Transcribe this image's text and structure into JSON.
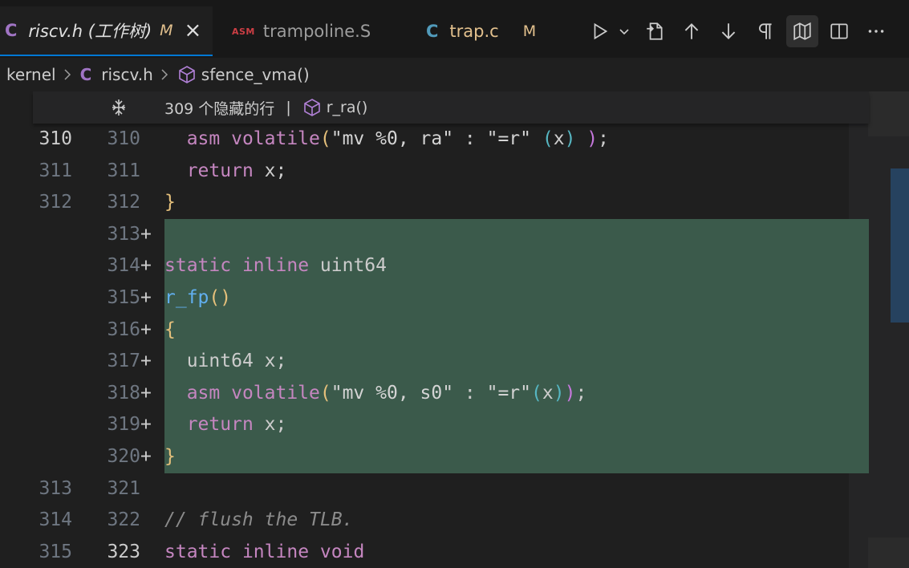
{
  "tabs": [
    {
      "icon": "C",
      "name": "riscv.h (工作树)",
      "badge": "M",
      "close": "×"
    },
    {
      "icon": "ASM",
      "name": "trampoline.S"
    },
    {
      "icon": "C",
      "name": "trap.c",
      "badge": "M"
    }
  ],
  "breadcrumb": {
    "folder": "kernel",
    "file_icon": "C",
    "file": "riscv.h",
    "symbol": "sfence_vma()"
  },
  "sticky": {
    "hidden_lines": "309 个隐藏的行",
    "separator": "|",
    "symbol": "r_ra()"
  },
  "gutter": {
    "plus": "+"
  },
  "lines": [
    {
      "old": "310",
      "new": "310"
    },
    {
      "old": "311",
      "new": "311"
    },
    {
      "old": "312",
      "new": "312"
    },
    {
      "old": "",
      "new": "313"
    },
    {
      "old": "",
      "new": "314"
    },
    {
      "old": "",
      "new": "315"
    },
    {
      "old": "",
      "new": "316"
    },
    {
      "old": "",
      "new": "317"
    },
    {
      "old": "",
      "new": "318"
    },
    {
      "old": "",
      "new": "319"
    },
    {
      "old": "",
      "new": "320"
    },
    {
      "old": "313",
      "new": "321"
    },
    {
      "old": "314",
      "new": "322"
    },
    {
      "old": "315",
      "new": "323"
    }
  ],
  "code": {
    "l310": {
      "kw": "asm volatile",
      "open": "(",
      "str": "\"mv %0, ra\"",
      "colon": " : ",
      "cons": "\"=r\"",
      "sp": " ",
      "p_open": "(",
      "var": "x",
      "p_close": ")",
      "sp2": " ",
      "close": ")",
      "semi": ";"
    },
    "l311": {
      "kw": "return",
      "rest": " x;"
    },
    "l312": {
      "brace": "}"
    },
    "l314": {
      "kw1": "static",
      "kw2": "inline",
      "type": "uint64"
    },
    "l315": {
      "fn": "r_fp",
      "parens": "()"
    },
    "l316": {
      "brace": "{"
    },
    "l317": {
      "text": "uint64 x;"
    },
    "l318": {
      "kw": "asm volatile",
      "open": "(",
      "str": "\"mv %0, s0\"",
      "colon": " : ",
      "cons": "\"=r\"",
      "p_open": "(",
      "var": "x",
      "p_close": ")",
      "close": ")",
      "semi": ";"
    },
    "l319": {
      "kw": "return",
      "rest": " x;"
    },
    "l320": {
      "brace": "}"
    },
    "l322": {
      "comment": "// flush the TLB."
    },
    "l323": {
      "kw1": "static",
      "kw2": "inline",
      "kw3": "void"
    }
  },
  "colors": {
    "added_bg": "#3b5a4b",
    "keyword": "#c586c0",
    "function": "#61afef",
    "modified": "#e2c08d",
    "accent": "#0078d4"
  }
}
